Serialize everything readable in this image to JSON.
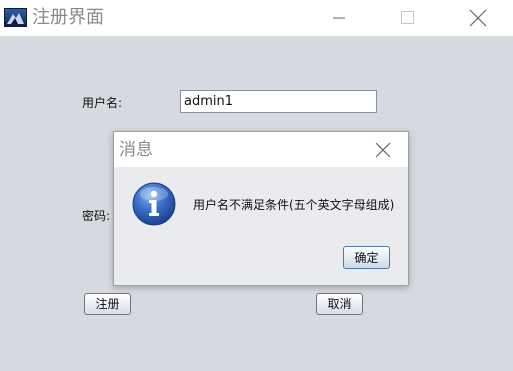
{
  "window": {
    "title": "注册界面",
    "icon": "app-icon"
  },
  "form": {
    "username_label": "用户名:",
    "username_value": "admin1",
    "password_label": "密码:",
    "register_button": "注册",
    "cancel_button": "取消"
  },
  "dialog": {
    "title": "消息",
    "message": "用户名不满足条件(五个英文字母组成)",
    "ok_button": "确定",
    "icon": "info-icon"
  },
  "colors": {
    "client_bg": "#d6d9df",
    "dialog_bg": "#eaebef",
    "info_blue": "#2b5fb4"
  }
}
